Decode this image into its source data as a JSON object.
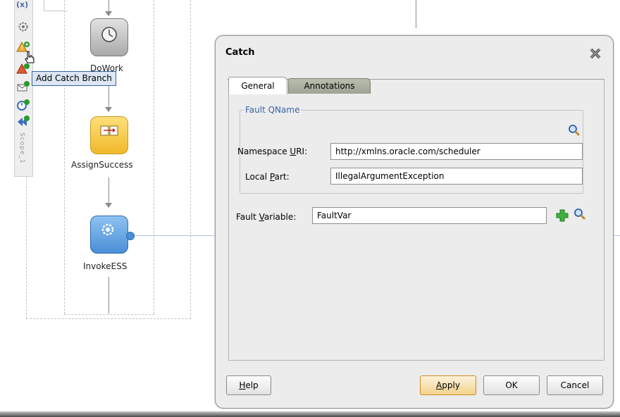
{
  "palette": {
    "top_glyph": "(x)",
    "vertical_label": "Scope_1",
    "icons": [
      "gear-icon",
      "catch-add-icon",
      "catch-all-add-icon",
      "message-add-icon",
      "timer-add-icon",
      "compensate-add-icon"
    ]
  },
  "tooltip": {
    "text": "Add Catch Branch"
  },
  "flow": {
    "nodes": [
      {
        "label": "DoWork",
        "icon": "clock-icon"
      },
      {
        "label": "AssignSuccess",
        "icon": "assign-icon"
      },
      {
        "label": "InvokeESS",
        "icon": "gear-icon"
      }
    ]
  },
  "dialog": {
    "title": "Catch",
    "tabs": [
      {
        "label": "General",
        "active": true
      },
      {
        "label": "Annotations",
        "active": false
      }
    ],
    "fault_qname": {
      "legend": "Fault QName",
      "namespace_label_pre": "Namespace ",
      "namespace_label_mn": "U",
      "namespace_label_post": "RI:",
      "namespace_value": "http://xmlns.oracle.com/scheduler",
      "local_label_pre": "Local ",
      "local_label_mn": "P",
      "local_label_post": "art:",
      "local_value": "IllegalArgumentException"
    },
    "fault_variable": {
      "label_pre": "Fault ",
      "label_mn": "V",
      "label_post": "ariable:",
      "value": "FaultVar"
    },
    "buttons": {
      "help_mn": "H",
      "help_rest": "elp",
      "apply_mn": "A",
      "apply_rest": "pply",
      "ok": "OK",
      "cancel": "Cancel"
    }
  },
  "colors": {
    "accent_blue": "#4a90d9",
    "legend_blue": "#3a64a8",
    "assign_yellow": "#f4c443",
    "invoke_blue": "#5aa0e0",
    "plus_green": "#2a9a2a"
  }
}
